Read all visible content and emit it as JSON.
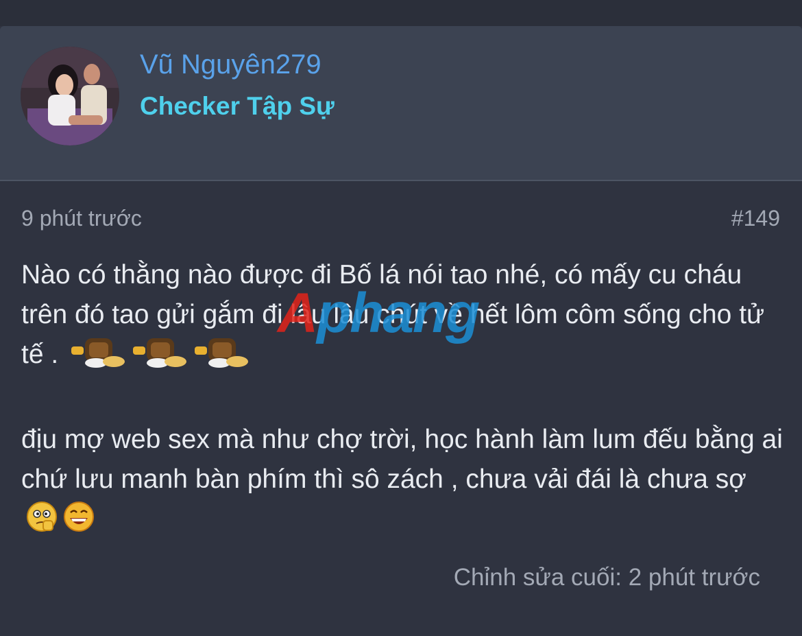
{
  "post": {
    "author": {
      "name": "Vũ Nguyên279",
      "title": "Checker Tập Sự"
    },
    "time": "9 phút trước",
    "number": "#149",
    "paragraph1_text": "Nào có thằng nào được đi Bố lá nói tao nhé, có mấy cu cháu trên đó tao gửi gắm đi lâu lâu chút về hết lôm côm sống cho tử tế .",
    "paragraph1_smileys": [
      "carry-smiley-icon",
      "carry-smiley-icon",
      "carry-smiley-icon"
    ],
    "paragraph2_text": "địu mợ web sex mà như chợ trời, học hành làm lum đếu bằng ai chứ lưu manh bàn phím thì sô zách , chưa vải đái là chưa sợ",
    "paragraph2_smileys": [
      "thinking-smiley-icon",
      "laughing-smiley-icon"
    ],
    "edited": "Chỉnh sửa cuối: 2 phút trước"
  },
  "watermark": {
    "text_red": "A",
    "text_blue": "phang"
  },
  "colors": {
    "background": "#2f3340",
    "header": "#3c4352",
    "username": "#5aa2ea",
    "user_title": "#4fd0ec",
    "meta": "#a3a9b5",
    "body_text": "#e9ecf1",
    "watermark_red": "#e2231a",
    "watermark_blue": "#1c8fd6"
  }
}
